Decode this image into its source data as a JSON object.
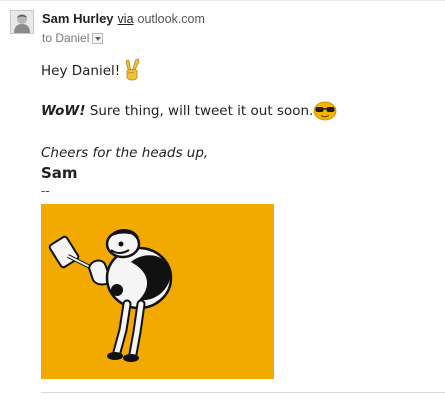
{
  "message": {
    "sender_name": "Sam Hurley",
    "via_label": "via",
    "via_domain": "outlook.com",
    "recipient_text": "to Daniel",
    "greeting": "Hey Daniel!",
    "reply_bold": "WoW!",
    "reply_text": " Sure thing, will tweet it out soon...",
    "cheers": "Cheers for the heads up,",
    "signature_name": "Sam",
    "separator": "--"
  },
  "colors": {
    "image_background": "#f2a900",
    "emoji_yellow": "#f4b400"
  },
  "icons": {
    "peace": "victory-hand-icon",
    "shades": "sunglasses-emoji-icon",
    "recipient_menu": "chevron-down-icon"
  }
}
